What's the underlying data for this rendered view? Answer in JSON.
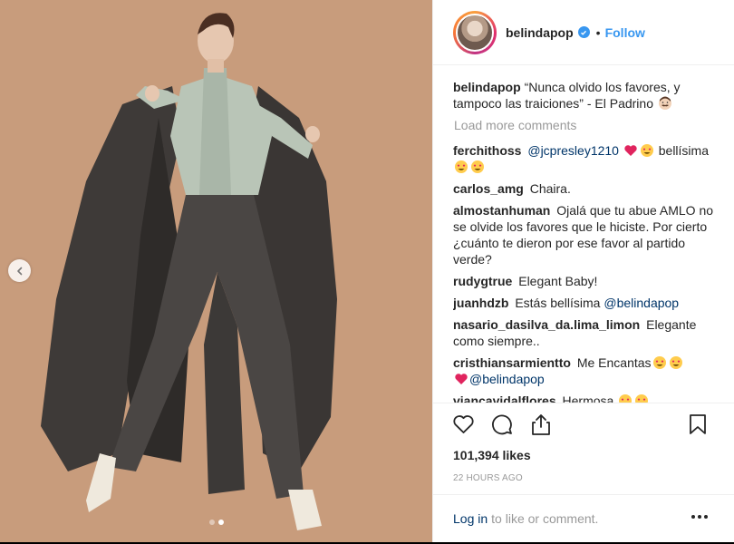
{
  "post": {
    "author": "belindapop",
    "follow_label": "Follow",
    "separator": "•",
    "caption": {
      "username": "belindapop",
      "text": "“Nunca olvido los favores, y tampoco las traiciones” - El Padrino"
    },
    "load_more_label": "Load more comments",
    "comments": [
      {
        "user": "ferchithoss",
        "mention": "@jcpresley1210",
        "text": "bellísima"
      },
      {
        "user": "carlos_amg",
        "text": "Chaira."
      },
      {
        "user": "almostanhuman",
        "text": "Ojalá que tu abue AMLO no se olvide los favores que le hiciste. Por cierto ¿cuánto te dieron por ese favor al partido verde?"
      },
      {
        "user": "rudygtrue",
        "text": "Elegant Baby!"
      },
      {
        "user": "juanhdzb",
        "text": "Estás bellísima",
        "mention": "@belindapop"
      },
      {
        "user": "nasario_dasilva_da.lima_limon",
        "text": "Elegante como siempre.."
      },
      {
        "user": "cristhiansarmientto",
        "text": "Me Encantas",
        "mention": "@belindapop"
      },
      {
        "user": "viancavidalflores",
        "text": "Hermosa"
      }
    ],
    "likes": "101,394 likes",
    "timestamp": "22 HOURS AGO",
    "login_label": "Log in",
    "login_rest": "to like or comment.",
    "carousel": {
      "count": 2,
      "active": 2
    }
  },
  "colors": {
    "accent": "#3897f0",
    "mention": "#003569",
    "muted": "#999999",
    "photo_background": "#c89c7c"
  },
  "icons": [
    "chevron-left-icon",
    "verified-badge-icon",
    "heart-icon",
    "comment-icon",
    "share-icon",
    "bookmark-icon",
    "more-options-icon"
  ]
}
